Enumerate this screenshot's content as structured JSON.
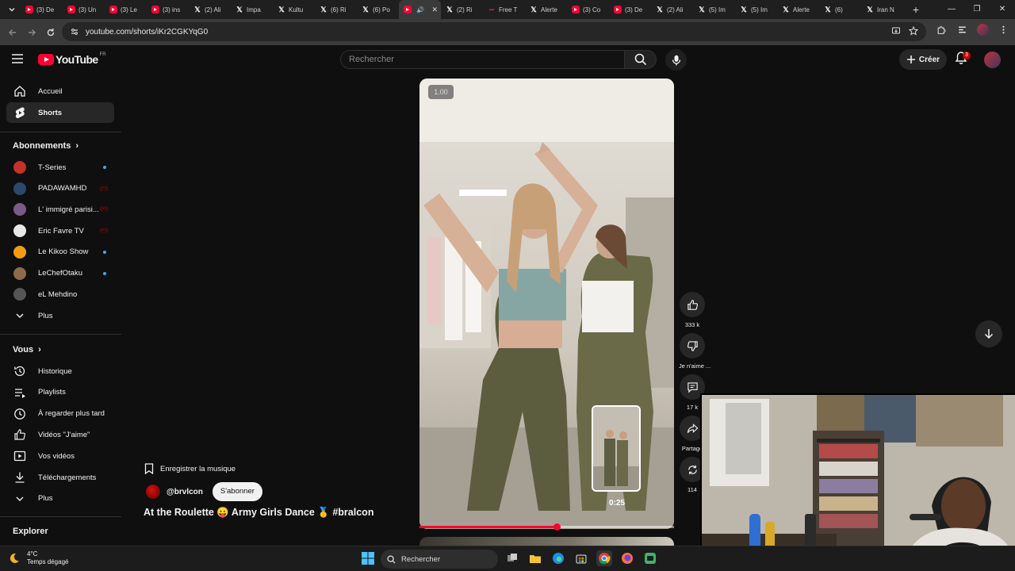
{
  "browser": {
    "tabs": [
      {
        "type": "yt",
        "title": "(3) De"
      },
      {
        "type": "yt",
        "title": "(3) Un"
      },
      {
        "type": "yt",
        "title": "(3) Le"
      },
      {
        "type": "yt",
        "title": "(3) ins"
      },
      {
        "type": "x",
        "title": "(2) Ali"
      },
      {
        "type": "x",
        "title": "Impa"
      },
      {
        "type": "x",
        "title": "Kultu"
      },
      {
        "type": "x",
        "title": "(6) Ri"
      },
      {
        "type": "x",
        "title": "(6) Po"
      },
      {
        "type": "yt",
        "title": "",
        "active": true
      },
      {
        "type": "x",
        "title": "(2) Ri"
      },
      {
        "type": "other",
        "title": "Free T"
      },
      {
        "type": "x",
        "title": "Alerte"
      },
      {
        "type": "yt",
        "title": "(3) Co"
      },
      {
        "type": "yt",
        "title": "(3) De"
      },
      {
        "type": "x",
        "title": "(2) Ali"
      },
      {
        "type": "x",
        "title": "(5) Im"
      },
      {
        "type": "x",
        "title": "(5) Im"
      },
      {
        "type": "x",
        "title": "Alerte"
      },
      {
        "type": "x",
        "title": "(6)"
      },
      {
        "type": "x",
        "title": "Iran N"
      }
    ],
    "close_glyph": "✕",
    "url": "youtube.com/shorts/iKr2CGKYqG0"
  },
  "header": {
    "logo_text": "YouTube",
    "country_code": "FR",
    "search_placeholder": "Rechercher",
    "create_label": "Créer",
    "notifications_count": "3"
  },
  "sidebar": {
    "main": [
      {
        "label": "Accueil",
        "icon": "home-icon"
      },
      {
        "label": "Shorts",
        "icon": "shorts-icon",
        "active": true
      }
    ],
    "subscriptions_title": "Abonnements",
    "subscriptions": [
      {
        "label": "T-Series",
        "status": "dot",
        "color": "#c4302b"
      },
      {
        "label": "PADAWAMHD",
        "status": "live",
        "color": "#2b4a6b"
      },
      {
        "label": "L' immigré parisi...",
        "status": "live",
        "color": "#7a5a8a"
      },
      {
        "label": "Eric Favre TV",
        "status": "live",
        "color": "#e8e8e8"
      },
      {
        "label": "Le Kikoo Show",
        "status": "dot",
        "color": "#f39c12"
      },
      {
        "label": "LeChefOtaku",
        "status": "dot",
        "color": "#8e6a4a"
      },
      {
        "label": "eL Mehdino",
        "status": "none",
        "color": "#555555"
      }
    ],
    "subscriptions_more": "Plus",
    "you_title": "Vous",
    "you_items": [
      {
        "label": "Historique",
        "icon": "history-icon"
      },
      {
        "label": "Playlists",
        "icon": "playlists-icon"
      },
      {
        "label": "À regarder plus tard",
        "icon": "watch-later-icon"
      },
      {
        "label": "Vidéos \"J'aime\"",
        "icon": "liked-videos-icon"
      },
      {
        "label": "Vos vidéos",
        "icon": "your-videos-icon"
      },
      {
        "label": "Téléchargements",
        "icon": "downloads-icon"
      },
      {
        "label": "Plus",
        "icon": "chevron-down-icon"
      }
    ],
    "explore_title": "Explorer"
  },
  "short": {
    "speed": "1.00",
    "preview_time": "0:25",
    "progress": 0.54,
    "save_music": "Enregistrer la musique",
    "channel": "@brvlcon",
    "subscribe": "S'abonner",
    "title": "At the Roulette 😛 Army Girls Dance 🥇 #bralcon",
    "actions": {
      "likes": "333 k",
      "dislike": "Je n'aime ...",
      "comments": "17 k",
      "share": "Partage",
      "remix": "114"
    }
  },
  "taskbar": {
    "weather_temp": "4°C",
    "weather_desc": "Temps dégagé",
    "search": "Rechercher"
  }
}
